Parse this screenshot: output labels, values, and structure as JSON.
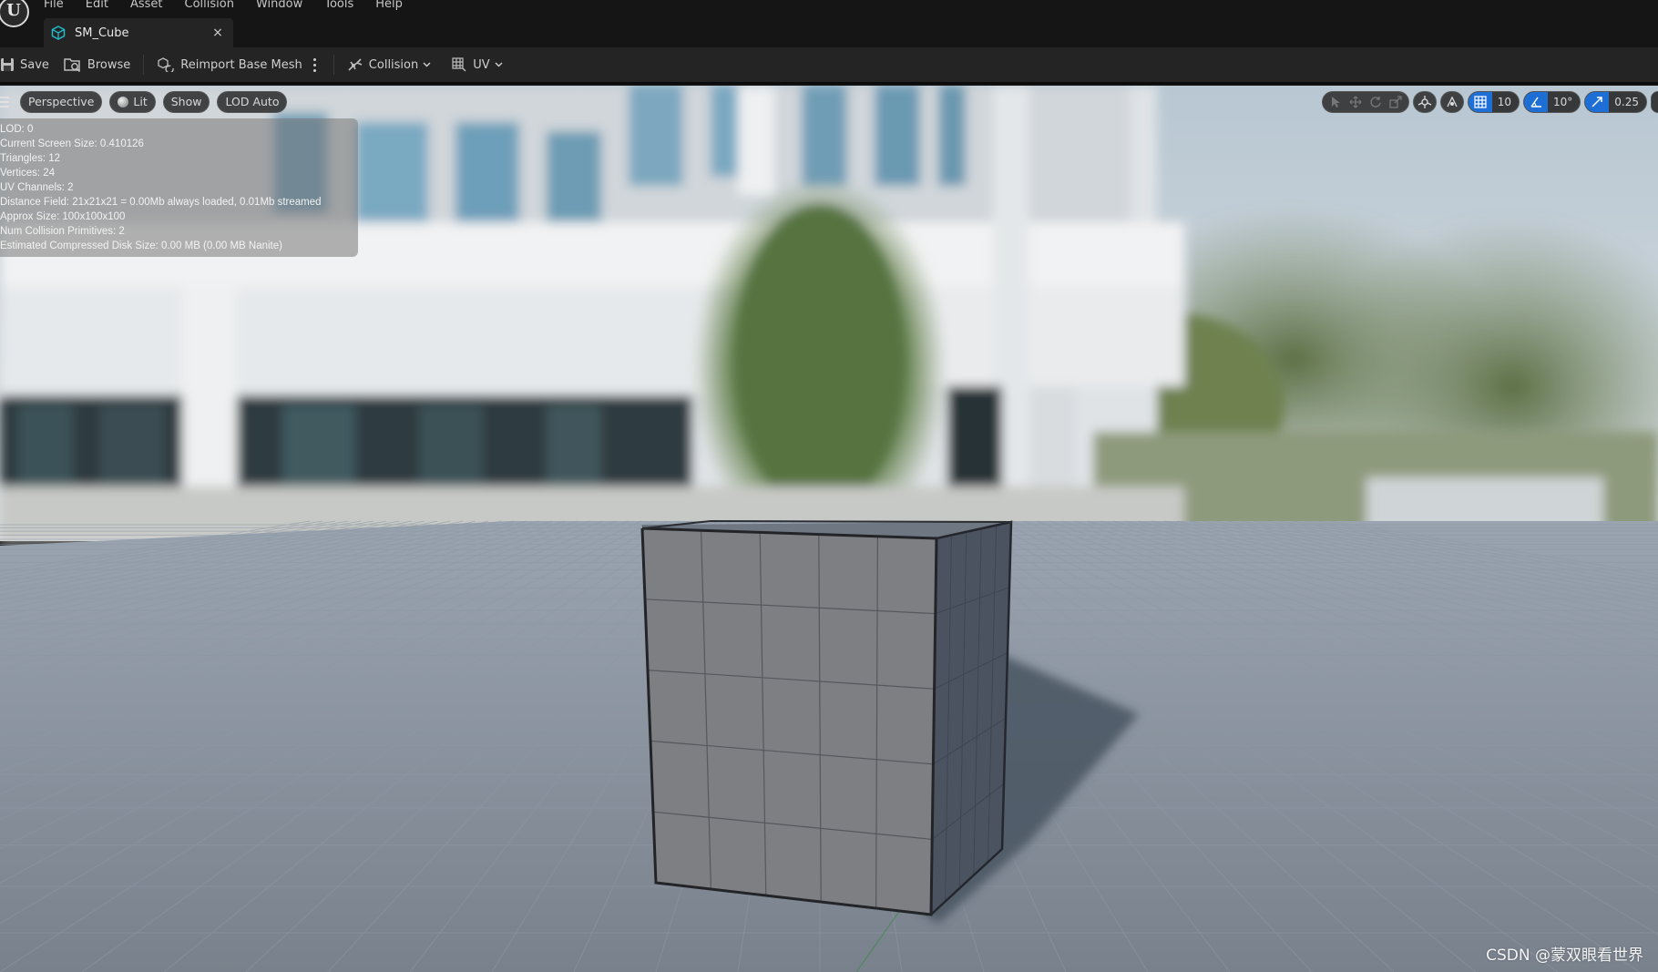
{
  "app": {
    "logo_text": "U"
  },
  "menu": [
    "File",
    "Edit",
    "Asset",
    "Collision",
    "Window",
    "Tools",
    "Help"
  ],
  "tab": {
    "label": "SM_Cube",
    "close": "×",
    "icon": "static-mesh-icon"
  },
  "toolbar": {
    "save_label": "Save",
    "browse_label": "Browse",
    "reimport_label": "Reimport Base Mesh",
    "collision_label": "Collision",
    "uv_label": "UV"
  },
  "viewport": {
    "perspective_label": "Perspective",
    "lit_label": "Lit",
    "show_label": "Show",
    "lod_label": "LOD Auto",
    "grid_snap_value": "10",
    "rotation_snap_value": "10°",
    "scale_snap_value": "0.25"
  },
  "stats": [
    "LOD:  0",
    "Current Screen Size:  0.410126",
    "Triangles:  12",
    "Vertices:  24",
    "UV Channels:  2",
    "Distance Field:  21x21x21 = 0.00Mb always loaded, 0.01Mb streamed",
    "Approx Size: 100x100x100",
    "Num Collision Primitives:  2",
    "Estimated Compressed Disk Size: 0.00 MB (0.00 MB Nanite)"
  ],
  "watermark": "CSDN @蒙双眼看世界",
  "colors": {
    "accent": "#1d6fd6",
    "tab_icon": "#22b8c8",
    "background": "#151515"
  }
}
